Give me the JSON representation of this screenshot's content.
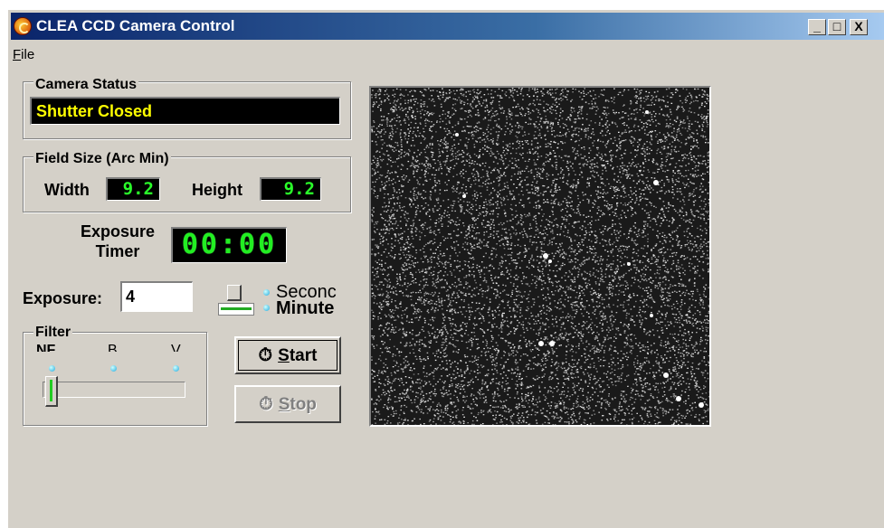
{
  "window": {
    "title": "CLEA CCD Camera Control",
    "controls": {
      "minimize": "_",
      "maximize": "□",
      "close": "X"
    }
  },
  "menu": {
    "file_label": "File"
  },
  "camera_status": {
    "group_label": "Camera Status",
    "status_text": "Shutter Closed",
    "status_color": "#ffff00"
  },
  "field_size": {
    "group_label": "Field Size (Arc Min)",
    "width_label": "Width",
    "width_value": "9.2",
    "height_label": "Height",
    "height_value": "9.2"
  },
  "exposure_timer": {
    "label_line1": "Exposure",
    "label_line2": "Timer",
    "display": "00:00"
  },
  "exposure": {
    "label": "Exposure:",
    "value": "4",
    "unit_seconds": "Seconc",
    "unit_minutes": "Minute",
    "selected_unit": "Minute"
  },
  "filter": {
    "group_label": "Filter",
    "options": [
      "NF",
      "B",
      "V"
    ],
    "selected": "NF",
    "position": 0
  },
  "buttons": {
    "start_label": "Start",
    "stop_label": "Stop",
    "start_icon": "stopwatch-icon",
    "stop_icon": "stopwatch-icon",
    "stop_enabled": false
  },
  "ccd_image": {
    "description_icon": "star-field",
    "background": "#1a1a1a"
  }
}
